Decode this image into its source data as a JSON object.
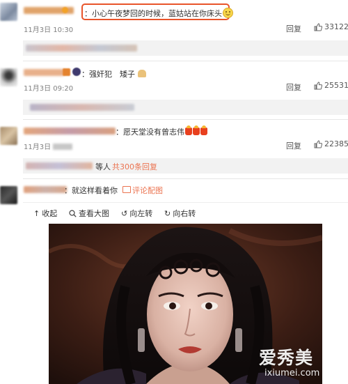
{
  "comments": [
    {
      "text": "：小心午夜梦回的时候，蓝姑站在你床头",
      "time": "11月3日 10:30",
      "reply_label": "回复",
      "likes": "33122"
    },
    {
      "text": "：强奸犯　矮子",
      "time": "11月3日 09:20",
      "reply_label": "回复",
      "likes": "25531"
    },
    {
      "text": "：愿天堂没有曾志伟",
      "time": "11月3日",
      "reply_label": "回复",
      "likes": "22385",
      "sub_prefix": "等人",
      "sub_link": "共300条回复"
    },
    {
      "text": "：就这样看着你",
      "image_link": "评论配图"
    }
  ],
  "image_toolbar": {
    "collapse": "收起",
    "view_large": "查看大图",
    "rotate_left": "向左转",
    "rotate_right": "向右转"
  },
  "watermark": {
    "cn": "爱秀美",
    "en": "ixiumei.com"
  },
  "colors": {
    "highlight_border": "#e8542a",
    "link": "#eb7350",
    "sub_bar": "#f2f2f2"
  }
}
